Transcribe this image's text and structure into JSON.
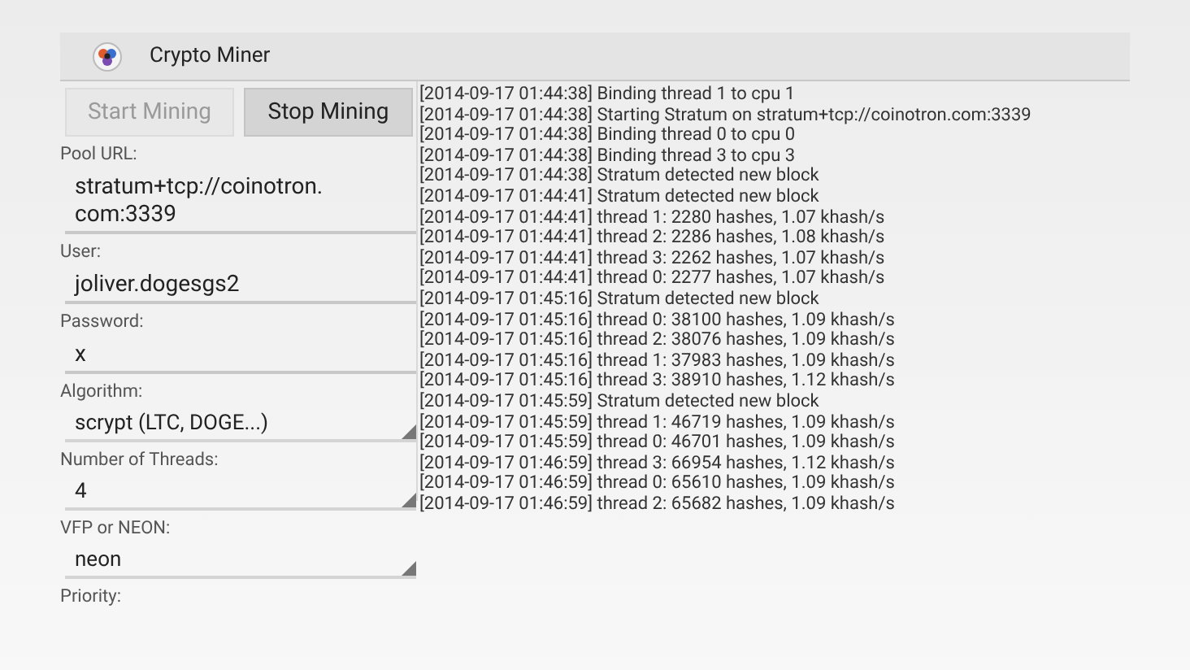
{
  "app_bar": {
    "title": "Crypto Miner"
  },
  "buttons": [
    {
      "label": "Start Mining",
      "disabled": true
    },
    {
      "label": "Stop Mining",
      "disabled": false
    }
  ],
  "fields": [
    {
      "label": "Pool URL:",
      "kind": "text",
      "value": "stratum+tcp://coinotron.\ncom:3339"
    },
    {
      "label": "User:",
      "kind": "text",
      "value": "joliver.dogesgs2"
    },
    {
      "label": "Password:",
      "kind": "text",
      "value": "x"
    },
    {
      "label": "Algorithm:",
      "kind": "spinner",
      "value": "scrypt (LTC, DOGE...)"
    },
    {
      "label": "Number of Threads:",
      "kind": "spinner",
      "value": "4"
    },
    {
      "label": "VFP or NEON:",
      "kind": "spinner",
      "value": "neon"
    },
    {
      "label": "Priority:",
      "kind": "cut"
    }
  ],
  "log": [
    "[2014-09-17 01:44:38] Binding thread 1 to cpu 1",
    "[2014-09-17 01:44:38] Starting Stratum on stratum+tcp://coinotron.com:3339",
    "[2014-09-17 01:44:38] Binding thread 0 to cpu 0",
    "[2014-09-17 01:44:38] Binding thread 3 to cpu 3",
    "[2014-09-17 01:44:38] Stratum detected new block",
    "[2014-09-17 01:44:41] Stratum detected new block",
    "[2014-09-17 01:44:41] thread 1: 2280 hashes, 1.07 khash/s",
    "[2014-09-17 01:44:41] thread 2: 2286 hashes, 1.08 khash/s",
    "[2014-09-17 01:44:41] thread 3: 2262 hashes, 1.07 khash/s",
    "[2014-09-17 01:44:41] thread 0: 2277 hashes, 1.07 khash/s",
    "[2014-09-17 01:45:16] Stratum detected new block",
    "[2014-09-17 01:45:16] thread 0: 38100 hashes, 1.09 khash/s",
    "[2014-09-17 01:45:16] thread 2: 38076 hashes, 1.09 khash/s",
    "[2014-09-17 01:45:16] thread 1: 37983 hashes, 1.09 khash/s",
    "[2014-09-17 01:45:16] thread 3: 38910 hashes, 1.12 khash/s",
    "[2014-09-17 01:45:59] Stratum detected new block",
    "[2014-09-17 01:45:59] thread 1: 46719 hashes, 1.09 khash/s",
    "[2014-09-17 01:45:59] thread 0: 46701 hashes, 1.09 khash/s",
    "[2014-09-17 01:46:59] thread 3: 66954 hashes, 1.12 khash/s",
    "[2014-09-17 01:46:59] thread 0: 65610 hashes, 1.09 khash/s",
    "[2014-09-17 01:46:59] thread 2: 65682 hashes, 1.09 khash/s"
  ]
}
